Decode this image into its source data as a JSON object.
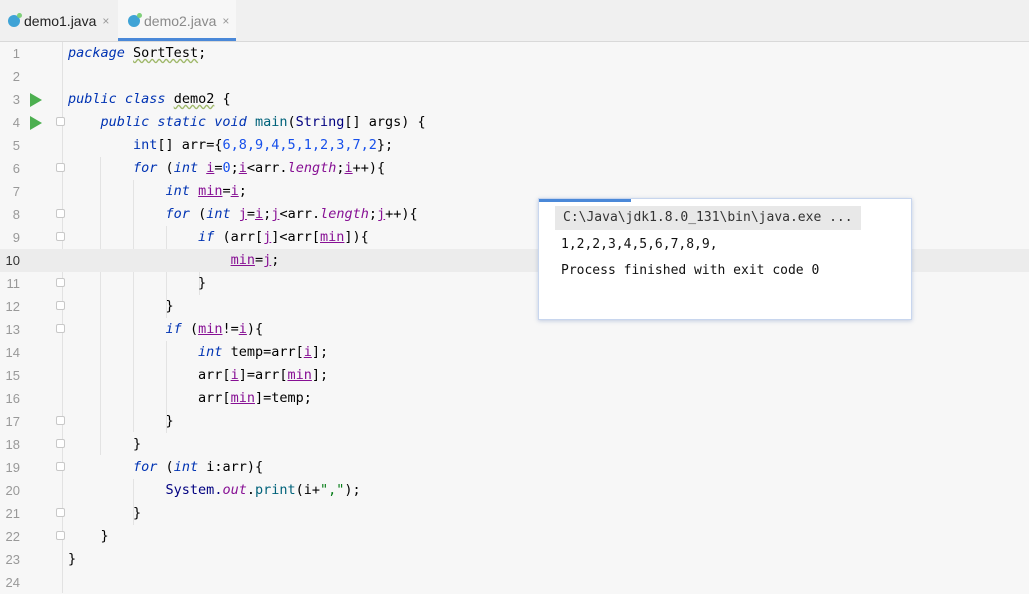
{
  "tabs": [
    {
      "label": "demo1.java",
      "close": "×"
    },
    {
      "label": "demo2.java",
      "close": "×"
    }
  ],
  "line_numbers": [
    "1",
    "2",
    "3",
    "4",
    "5",
    "6",
    "7",
    "8",
    "9",
    "10",
    "11",
    "12",
    "13",
    "14",
    "15",
    "16",
    "17",
    "18",
    "19",
    "20",
    "21",
    "22",
    "23",
    "24"
  ],
  "current_line": 10,
  "code": {
    "l1_kw": "package",
    "l1_pkg": "SortTest",
    "l1_semi": ";",
    "l3_kw": "public class",
    "l3_name": "demo2",
    "l3_brace": " {",
    "l4_kw": "public static void",
    "l4_m": "main",
    "l4_p1": "(",
    "l4_t": "String",
    "l4_p2": "[] args) {",
    "l5_t": "int",
    "l5_a": "[] arr={",
    "l5_n": "6,8,9,4,5,1,2,3,7,2",
    "l5_b": "};",
    "l6_kw": "for",
    "l6_a": " (",
    "l6_t": "int",
    "l6_i": "i",
    "l6_b": "=",
    "l6_n0": "0",
    "l6_c": ";",
    "l6_i2": "i",
    "l6_d": "<arr.",
    "l6_f": "length",
    "l6_e": ";",
    "l6_i3": "i",
    "l6_g": "++){",
    "l7_t": "int",
    "l7_v": "min",
    "l7_a": "=",
    "l7_i": "i",
    "l7_b": ";",
    "l8_kw": "for",
    "l8_a": " (",
    "l8_t": "int",
    "l8_j": "j",
    "l8_b": "=",
    "l8_i": "i",
    "l8_c": ";",
    "l8_j2": "j",
    "l8_d": "<arr.",
    "l8_f": "length",
    "l8_e": ";",
    "l8_j3": "j",
    "l8_g": "++){",
    "l9_kw": "if",
    "l9_a": " (arr[",
    "l9_j": "j",
    "l9_b": "]<arr[",
    "l9_m": "min",
    "l9_c": "]){",
    "l10_m": "min",
    "l10_a": "=",
    "l10_j": "j",
    "l10_b": ";",
    "l11": "}",
    "l12": "}",
    "l13_kw": "if",
    "l13_a": " (",
    "l13_m": "min",
    "l13_b": "!=",
    "l13_i": "i",
    "l13_c": "){",
    "l14_t": "int",
    "l14_a": " temp=arr[",
    "l14_i": "i",
    "l14_b": "];",
    "l15_a": "arr[",
    "l15_i": "i",
    "l15_b": "]=arr[",
    "l15_m": "min",
    "l15_c": "];",
    "l16_a": "arr[",
    "l16_m": "min",
    "l16_b": "]=temp;",
    "l17": "}",
    "l18": "}",
    "l19_kw": "for",
    "l19_a": " (",
    "l19_t": "int",
    "l19_b": " i:arr){",
    "l20_c": "System.",
    "l20_f": "out",
    "l20_d": ".",
    "l20_m": "print",
    "l20_e": "(i+",
    "l20_s": "\",\"",
    "l20_g": ");",
    "l21": "}",
    "l22": "}",
    "l23": "}"
  },
  "popup": {
    "command": "C:\\Java\\jdk1.8.0_131\\bin\\java.exe ...",
    "output": "1,2,2,3,4,5,6,7,8,9,",
    "status": "Process finished with exit code 0"
  }
}
